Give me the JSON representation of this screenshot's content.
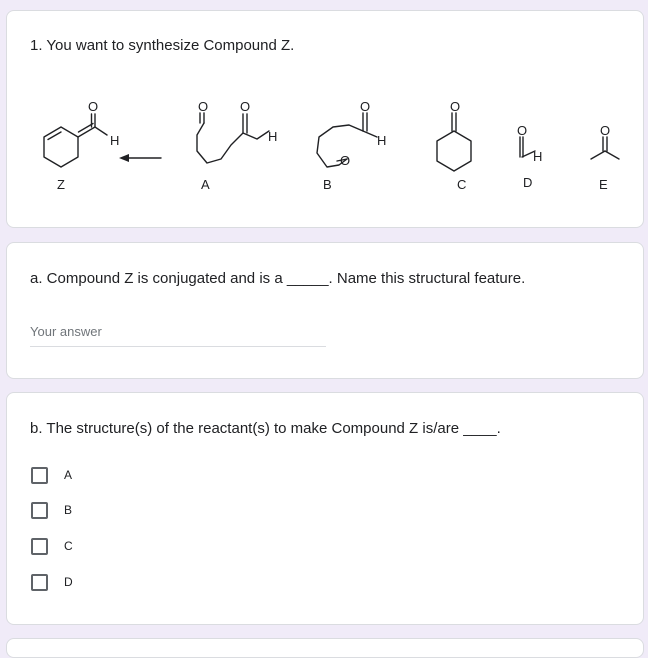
{
  "question1": {
    "title": "1. You want to synthesize Compound Z.",
    "scheme": {
      "atoms": {
        "oxygen": "O",
        "hydrogen": "H"
      },
      "arrow_icon": "arrow-left-icon",
      "labels": [
        "Z",
        "A",
        "B",
        "C",
        "D",
        "E"
      ]
    }
  },
  "part_a": {
    "prompt": "a. Compound Z is conjugated and is a _____. Name this structural feature.",
    "input_placeholder": "Your answer",
    "input_value": ""
  },
  "part_b": {
    "prompt": "b. The structure(s) of the reactant(s) to make Compound Z is/are ____.",
    "options": [
      {
        "label": "A",
        "checked": false
      },
      {
        "label": "B",
        "checked": false
      },
      {
        "label": "C",
        "checked": false
      },
      {
        "label": "D",
        "checked": false
      }
    ]
  },
  "colors": {
    "page_background": "#f0ebf8",
    "card_background": "#ffffff",
    "card_border": "#dadce0",
    "checkbox_border": "#5f6368",
    "placeholder": "#70757a"
  }
}
